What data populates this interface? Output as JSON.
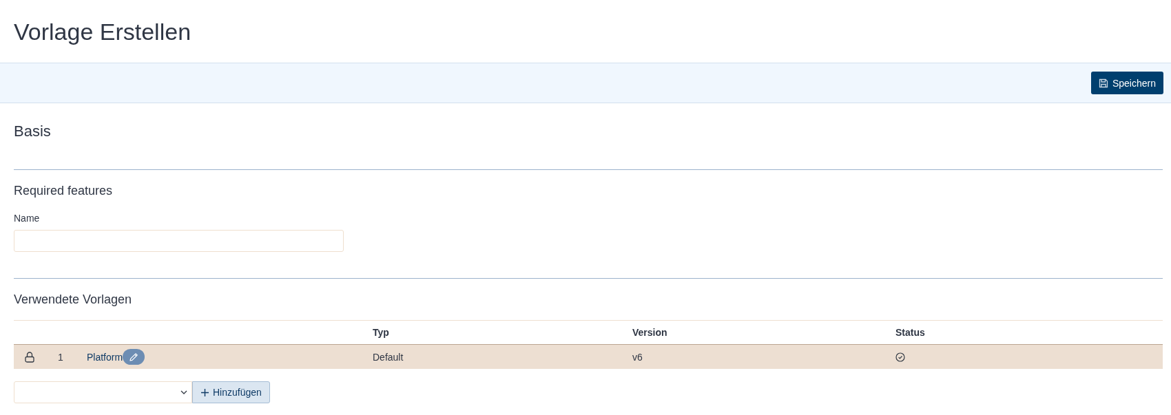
{
  "page": {
    "title": "Vorlage Erstellen"
  },
  "toolbar": {
    "save_button": "Speichern"
  },
  "basis": {
    "heading": "Basis"
  },
  "required_features": {
    "heading": "Required features",
    "fields": [
      {
        "label": "Name"
      }
    ]
  },
  "used_templates": {
    "heading": "Verwendete Vorlagen",
    "table": {
      "columns": [
        "Typ",
        "Version",
        "Status"
      ],
      "rows": [
        {
          "selected": true,
          "locked": true,
          "number": "1",
          "name": "Platform",
          "type": "Default",
          "version": "v6",
          "valid": true
        }
      ]
    },
    "add_button": "Hinzufügen"
  }
}
